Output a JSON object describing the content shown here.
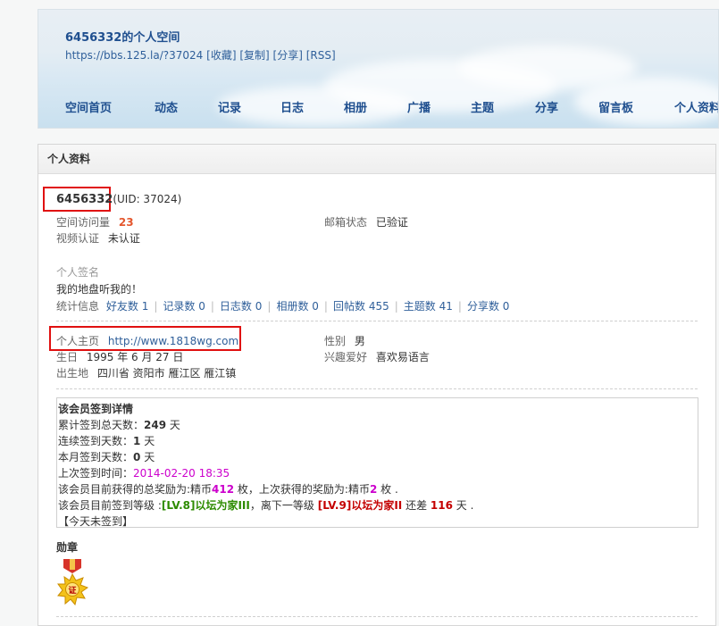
{
  "header": {
    "title": "6456332的个人空间",
    "url": "https://bbs.125.la/?37024",
    "actions": [
      "[收藏]",
      "[复制]",
      "[分享]",
      "[RSS]"
    ],
    "nav": [
      "空间首页",
      "动态",
      "记录",
      "日志",
      "相册",
      "广播",
      "主题",
      "分享",
      "留言板",
      "个人资料"
    ]
  },
  "panel": {
    "title": "个人资料",
    "username": "6456332",
    "uid": "(UID: 37024)",
    "visits_label": "空间访问量",
    "visits": "23",
    "email_label": "邮箱状态",
    "email_value": "已验证",
    "video_label": "视频认证",
    "video_value": "未认证",
    "sig_label": "个人签名",
    "sig_value": "我的地盘听我的！",
    "stats_label": "统计信息",
    "stats": [
      {
        "label": "好友数",
        "value": "1"
      },
      {
        "label": "记录数",
        "value": "0"
      },
      {
        "label": "日志数",
        "value": "0"
      },
      {
        "label": "相册数",
        "value": "0"
      },
      {
        "label": "回帖数",
        "value": "455"
      },
      {
        "label": "主题数",
        "value": "41"
      },
      {
        "label": "分享数",
        "value": "0"
      }
    ],
    "homepage_label": "个人主页",
    "homepage_value": "http://www.1818wg.com",
    "gender_label": "性别",
    "gender_value": "男",
    "birthday_label": "生日",
    "birthday_value": "1995 年 6 月 27 日",
    "hobby_label": "兴趣爱好",
    "hobby_value": "喜欢易语言",
    "birthplace_label": "出生地",
    "birthplace_value": "四川省 资阳市 雁江区 雁江镇"
  },
  "signin": {
    "title": "该会员签到详情",
    "total_label": "累计签到总天数：",
    "total_value": "249",
    "streak_label": "连续签到天数：",
    "streak_value": "1",
    "month_label": "本月签到天数：",
    "month_value": "0",
    "day_unit": " 天",
    "last_label": "上次签到时间：",
    "last_value": "2014-02-20 18:35",
    "reward_prefix": "该会员目前获得的总奖励为:精币",
    "reward_total": "412",
    "reward_mid": " 枚，上次获得的奖励为:精币",
    "reward_last": "2",
    "reward_suffix": " 枚 .",
    "level_prefix": "该会员目前签到等级 :",
    "level_current": "[LV.8]以坛为家III",
    "level_mid": "，离下一等级 ",
    "level_next": "[LV.9]以坛为家II",
    "level_gap_label": " 还差 ",
    "level_gap": "116",
    "level_suffix": " 天 .",
    "today": "【今天未签到】"
  },
  "medals": {
    "title": "勋章",
    "badge_char": "证"
  },
  "colors": {
    "nav_text": "#1f4f8f",
    "link": "#2f5f9a",
    "highlight_box": "#e01010",
    "visits": "#e4572e",
    "level_current": "#2d8b00",
    "level_next": "#c40000",
    "reward": "#cc00cc"
  }
}
